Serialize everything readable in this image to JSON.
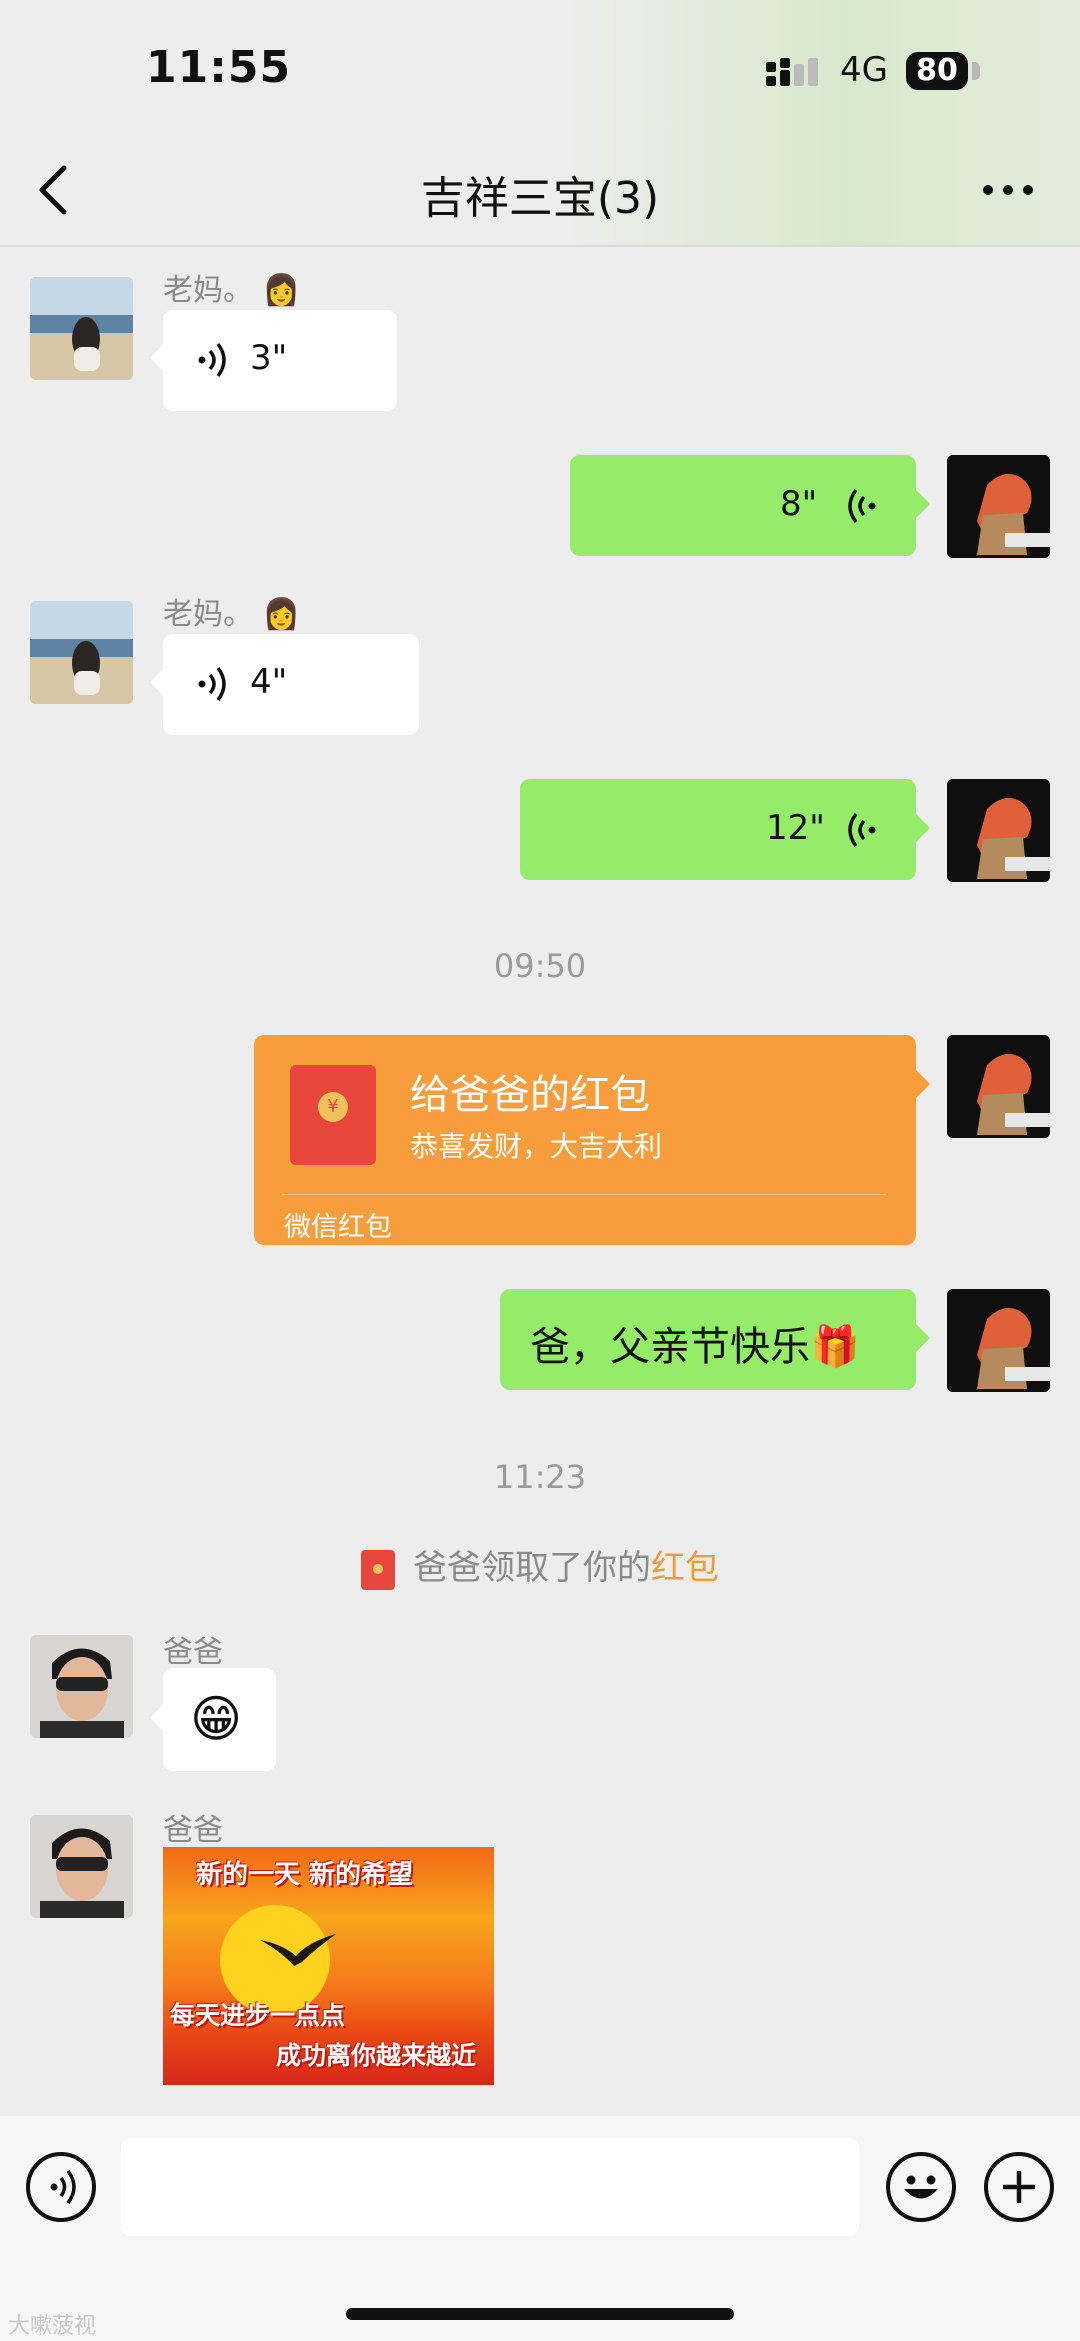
{
  "status_bar": {
    "time": "11:55",
    "network": "4G",
    "battery": "80"
  },
  "header": {
    "title": "吉祥三宝(3)"
  },
  "messages": [
    {
      "sender": "老妈。",
      "duration": "3\""
    },
    {
      "duration": "8\""
    },
    {
      "sender": "老妈。",
      "duration": "4\""
    },
    {
      "duration": "12\""
    }
  ],
  "timestamps": {
    "first": "09:50",
    "second": "11:23"
  },
  "red_packet": {
    "title": "给爸爸的红包",
    "subtitle": "恭喜发财，大吉大利",
    "footer": "微信红包",
    "coin": "¥"
  },
  "text_message": {
    "text": "爸，父亲节快乐",
    "emoji": "🎁"
  },
  "system_note": {
    "prefix": "爸爸领取了你的",
    "highlight": "红包"
  },
  "dad_messages": [
    {
      "sender": "爸爸",
      "emoji": "😁"
    },
    {
      "sender": "爸爸"
    }
  ],
  "sticker": {
    "line1": "新的一天   新的希望",
    "line2": "每天进步一点点",
    "line3": "成功离你越来越近"
  },
  "watermark": "大嗽菠视",
  "colors": {
    "green_bubble": "#95ec69",
    "red_packet": "#f89d3c",
    "accent": "#f39b3c"
  }
}
